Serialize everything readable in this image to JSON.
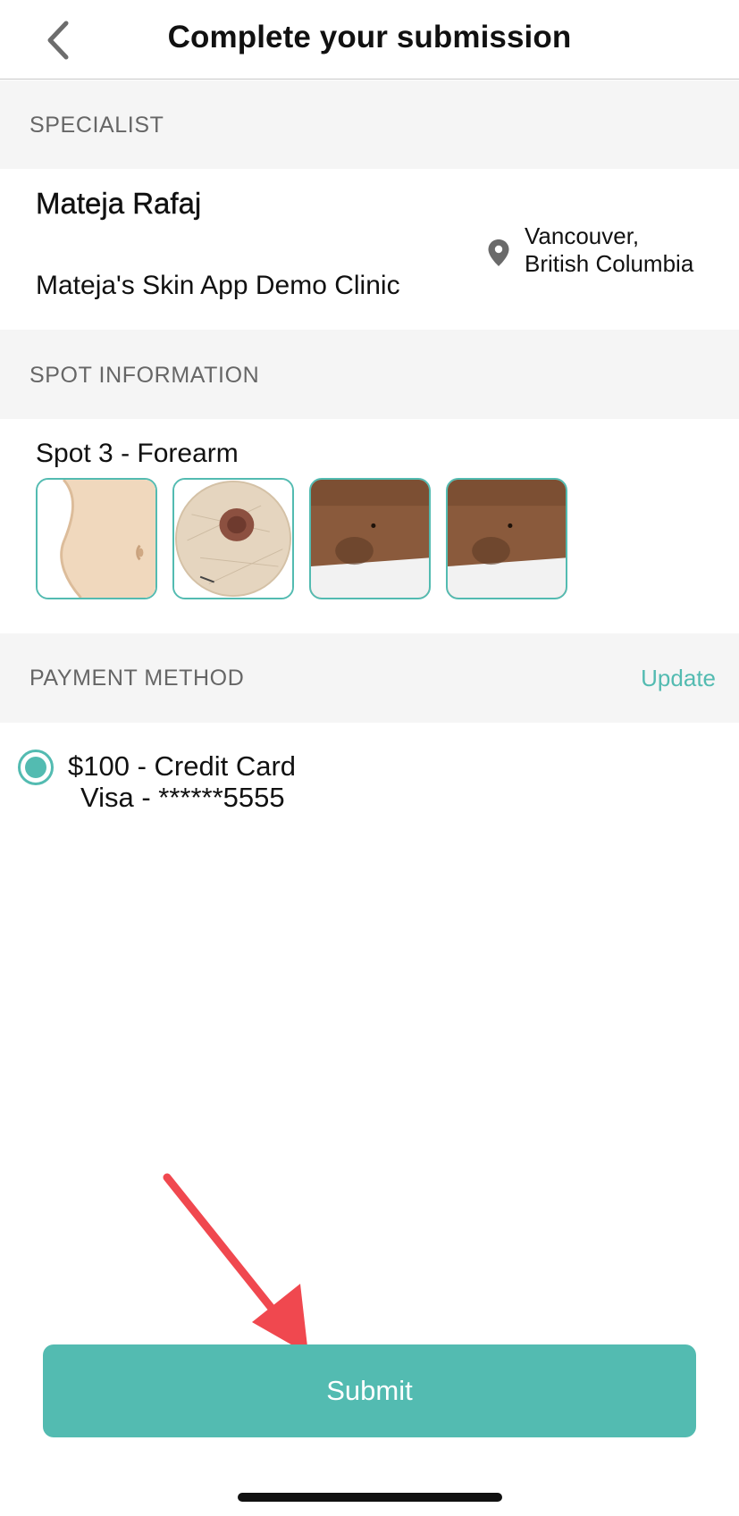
{
  "header": {
    "title": "Complete your submission",
    "back_icon": "chevron-left-icon"
  },
  "specialist": {
    "section_label": "SPECIALIST",
    "name": "Mateja Rafaj",
    "clinic": "Mateja's Skin App Demo Clinic",
    "location_icon": "map-pin-icon",
    "location_line1": "Vancouver,",
    "location_line2": "British Columbia"
  },
  "spot": {
    "section_label": "SPOT INFORMATION",
    "title": "Spot 3 - Forearm",
    "images": [
      {
        "name": "body-map-torso"
      },
      {
        "name": "dermoscopy-closeup"
      },
      {
        "name": "forearm-photo-1"
      },
      {
        "name": "forearm-photo-2"
      }
    ]
  },
  "payment": {
    "section_label": "PAYMENT METHOD",
    "update_label": "Update",
    "line1": "$100 - Credit Card",
    "line2": "Visa - ******5555",
    "selected": true
  },
  "footer": {
    "submit_label": "Submit"
  },
  "colors": {
    "accent": "#53bbb1",
    "section_bg": "#f5f5f5",
    "annotation_arrow": "#f0484f"
  }
}
